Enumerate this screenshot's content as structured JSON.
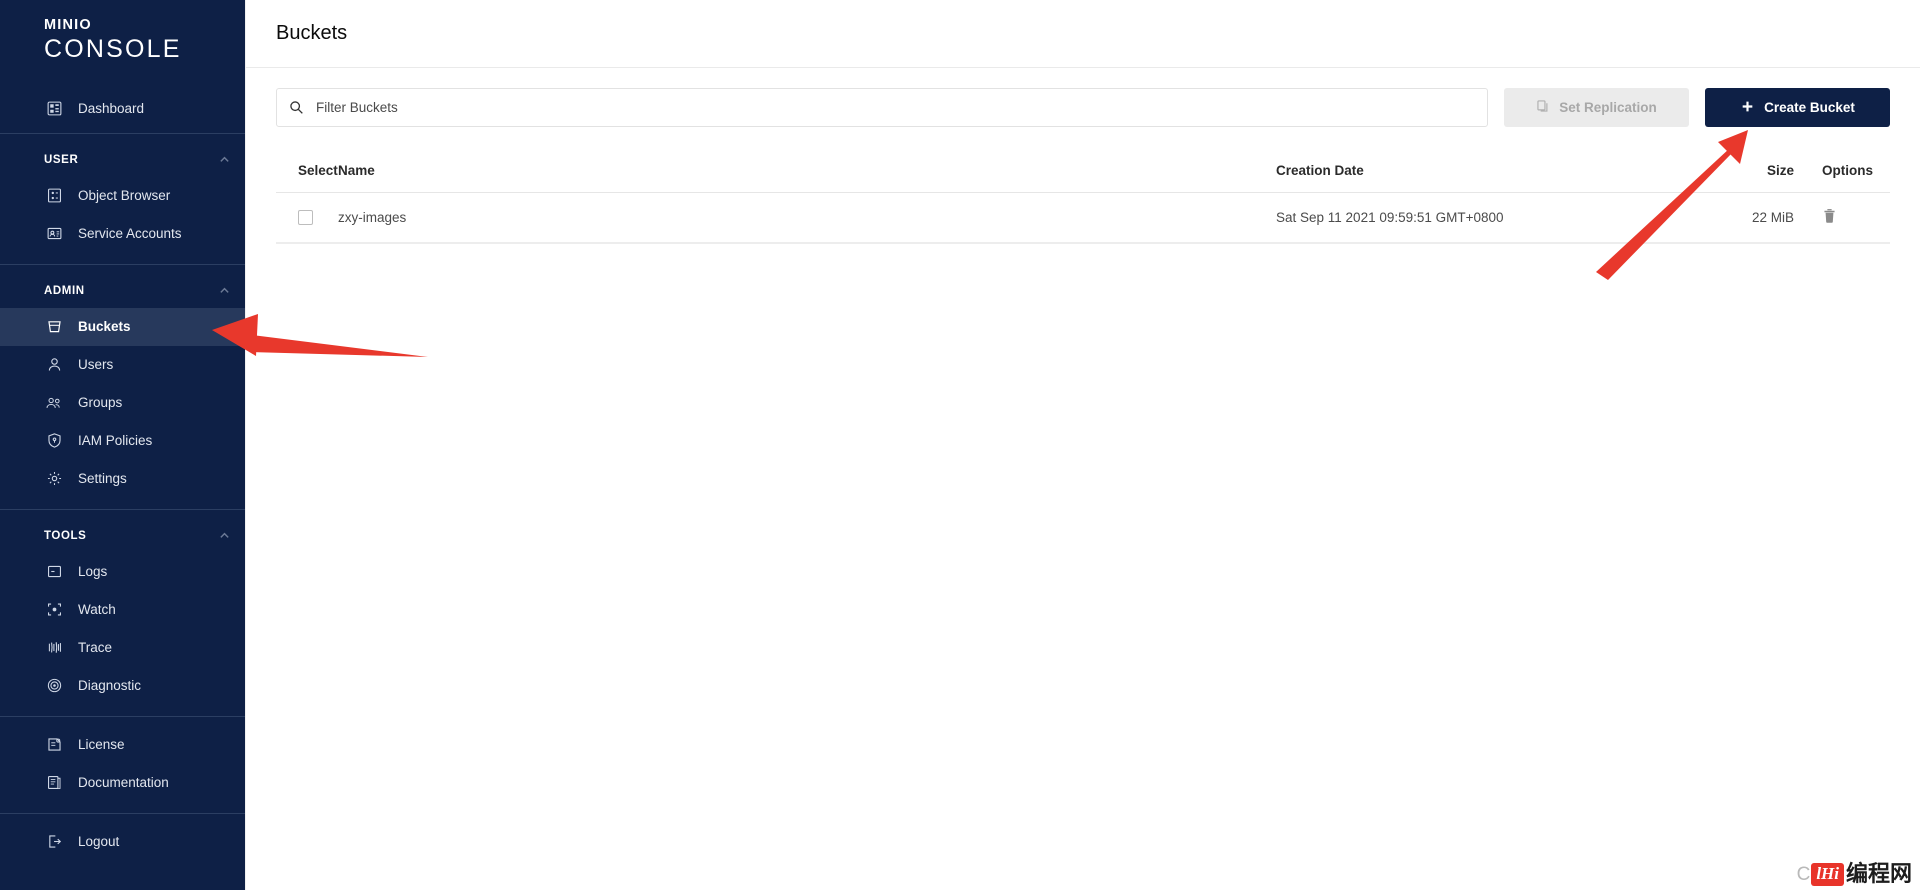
{
  "brand": {
    "logo_top": "MINIO",
    "logo_bottom": "CONSOLE"
  },
  "colors": {
    "sidebar_bg": "#0e2046",
    "sidebar_active_bg": "#27395c",
    "primary_button": "#0e2046",
    "annotation_arrow": "#e8382c",
    "page_bg": "#ffffff"
  },
  "sidebar": {
    "top_items": [
      {
        "label": "Dashboard",
        "icon": "dashboard-icon",
        "active": false
      }
    ],
    "sections": [
      {
        "title": "USER",
        "collapse_icon": "chevron-up-icon",
        "items": [
          {
            "label": "Object Browser",
            "icon": "object-browser-icon",
            "active": false
          },
          {
            "label": "Service Accounts",
            "icon": "service-accounts-icon",
            "active": false
          }
        ]
      },
      {
        "title": "ADMIN",
        "collapse_icon": "chevron-up-icon",
        "items": [
          {
            "label": "Buckets",
            "icon": "bucket-icon",
            "active": true
          },
          {
            "label": "Users",
            "icon": "user-icon",
            "active": false
          },
          {
            "label": "Groups",
            "icon": "groups-icon",
            "active": false
          },
          {
            "label": "IAM Policies",
            "icon": "shield-icon",
            "active": false
          },
          {
            "label": "Settings",
            "icon": "gear-icon",
            "active": false
          }
        ]
      },
      {
        "title": "TOOLS",
        "collapse_icon": "chevron-up-icon",
        "items": [
          {
            "label": "Logs",
            "icon": "logs-icon",
            "active": false
          },
          {
            "label": "Watch",
            "icon": "watch-icon",
            "active": false
          },
          {
            "label": "Trace",
            "icon": "trace-icon",
            "active": false
          },
          {
            "label": "Diagnostic",
            "icon": "diagnostic-icon",
            "active": false
          }
        ]
      }
    ],
    "footer_items": [
      {
        "label": "License",
        "icon": "license-icon"
      },
      {
        "label": "Documentation",
        "icon": "documentation-icon"
      }
    ],
    "logout": {
      "label": "Logout",
      "icon": "logout-icon"
    }
  },
  "header": {
    "title": "Buckets"
  },
  "toolbar": {
    "search_placeholder": "Filter Buckets",
    "search_value": "",
    "search_icon": "search-icon",
    "set_replication": {
      "label": "Set Replication",
      "icon": "copy-icon",
      "disabled": true
    },
    "create_bucket": {
      "label": "Create Bucket",
      "icon": "plus-icon"
    }
  },
  "table": {
    "columns": [
      "Select",
      "Name",
      "Creation Date",
      "Size",
      "Options"
    ],
    "rows": [
      {
        "selected": false,
        "name": "zxy-images",
        "creation_date": "Sat Sep 11 2021 09:59:51 GMT+0800",
        "size": "22 MiB",
        "options_icon": "trash-icon"
      }
    ]
  },
  "annotations": [
    {
      "type": "arrow",
      "target": "sidebar-item-buckets",
      "direction": "left"
    },
    {
      "type": "arrow",
      "target": "create-bucket-button",
      "direction": "up-right"
    }
  ],
  "watermark": {
    "prefix": "C",
    "badge": "lHi",
    "text": "编程网"
  }
}
